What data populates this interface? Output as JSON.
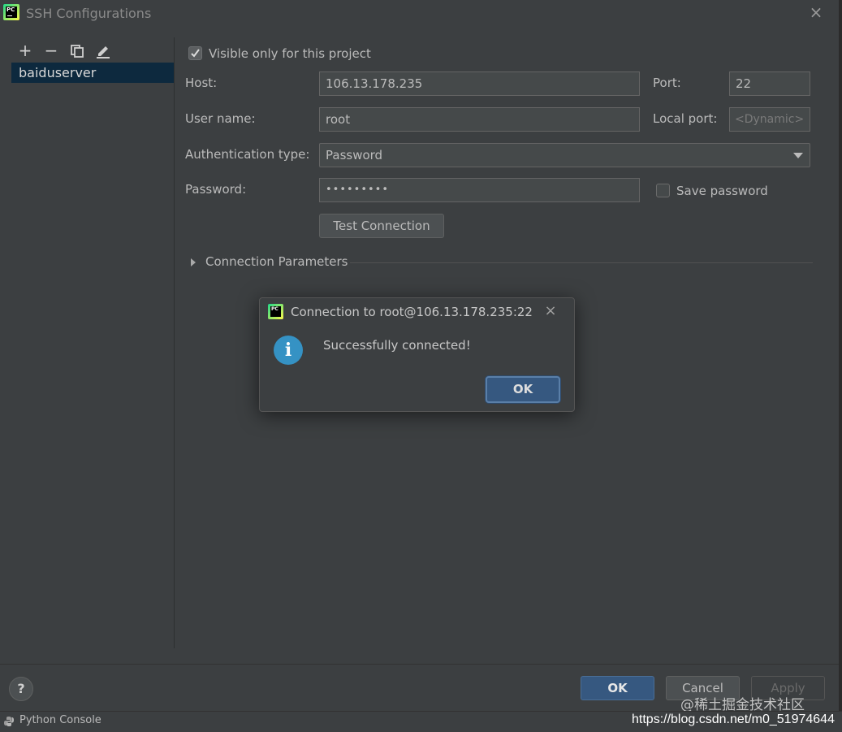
{
  "window": {
    "title": "SSH Configurations",
    "close_icon": "×"
  },
  "toolbar": {
    "add": "+",
    "remove": "−"
  },
  "configs": [
    {
      "name": "baiduserver"
    }
  ],
  "form": {
    "visible_only_label": "Visible only for this project",
    "host_label": "Host:",
    "host_value": "106.13.178.235",
    "port_label": "Port:",
    "port_value": "22",
    "username_label": "User name:",
    "username_value": "root",
    "local_port_label": "Local port:",
    "local_port_placeholder": "<Dynamic>",
    "auth_type_label": "Authentication type:",
    "auth_type_value": "Password",
    "password_label": "Password:",
    "password_value": "•••••••••",
    "save_password_label": "Save password",
    "test_connection_label": "Test Connection",
    "connection_params_label": "Connection Parameters"
  },
  "dialog": {
    "title": "Connection to root@106.13.178.235:22",
    "close_icon": "×",
    "info_icon": "i",
    "message": "Successfully connected!",
    "ok_label": "OK"
  },
  "footer": {
    "help_label": "?",
    "ok_label": "OK",
    "cancel_label": "Cancel",
    "apply_label": "Apply"
  },
  "statusbar": {
    "python_console_label": "Python Console"
  },
  "watermark": {
    "line1": "@稀土掘金技术社区",
    "line2": "https://blog.csdn.net/m0_51974644"
  },
  "colors": {
    "background": "#3c3f41",
    "selection": "#0d293e",
    "primary_button": "#365880",
    "info_icon": "#3592c4"
  }
}
